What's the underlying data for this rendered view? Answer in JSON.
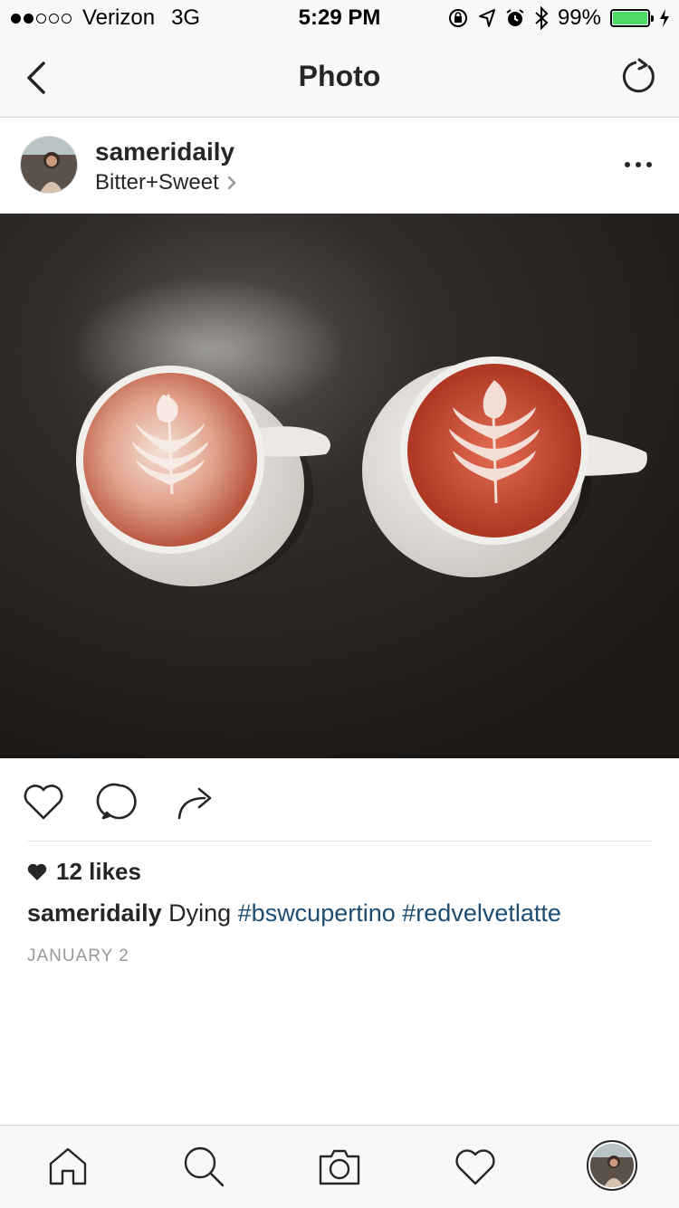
{
  "status_bar": {
    "carrier": "Verizon",
    "network": "3G",
    "time": "5:29 PM",
    "battery": "99%",
    "battery_level": 0.99
  },
  "nav": {
    "title": "Photo"
  },
  "post": {
    "username": "sameridaily",
    "location": "Bitter+Sweet",
    "likes": "12 likes",
    "caption_user": "sameridaily",
    "caption_text": "Dying",
    "hashtags": [
      "#bswcupertino",
      "#redvelvetlatte"
    ],
    "date": "JANUARY 2"
  },
  "icons": {
    "back": "chevron-left-icon",
    "refresh": "refresh-icon",
    "more": "more-icon",
    "like": "heart-icon",
    "comment": "comment-icon",
    "share": "share-icon",
    "home": "home-icon",
    "search": "search-icon",
    "camera": "camera-icon",
    "activity": "heart-icon",
    "profile": "avatar"
  },
  "colors": {
    "hashtag": "#1e4d73",
    "battery_fill": "#4cd964"
  }
}
